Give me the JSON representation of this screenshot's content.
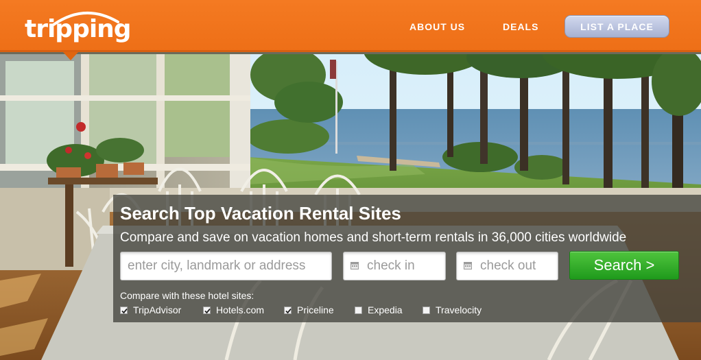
{
  "brand": {
    "name": "tripping"
  },
  "nav": {
    "about_label": "ABOUT US",
    "deals_label": "DEALS",
    "list_place_label": "LIST A PLACE"
  },
  "search": {
    "headline": "Search Top Vacation Rental Sites",
    "subline": "Compare and save on vacation homes and short-term rentals in 36,000 cities worldwide",
    "location_placeholder": "enter city, landmark or address",
    "checkin_placeholder": "check in",
    "checkout_placeholder": "check out",
    "button_label": "Search >",
    "compare_label": "Compare with these hotel sites:",
    "sites": [
      {
        "label": "TripAdvisor",
        "checked": true
      },
      {
        "label": "Hotels.com",
        "checked": true
      },
      {
        "label": "Priceline",
        "checked": true
      },
      {
        "label": "Expedia",
        "checked": false
      },
      {
        "label": "Travelocity",
        "checked": false
      }
    ]
  },
  "colors": {
    "header_orange": "#f47a22",
    "search_green": "#2fae28",
    "list_button": "#b9c2df"
  },
  "icons": {
    "calendar": "calendar-icon",
    "checkbox": "checkbox-icon"
  }
}
